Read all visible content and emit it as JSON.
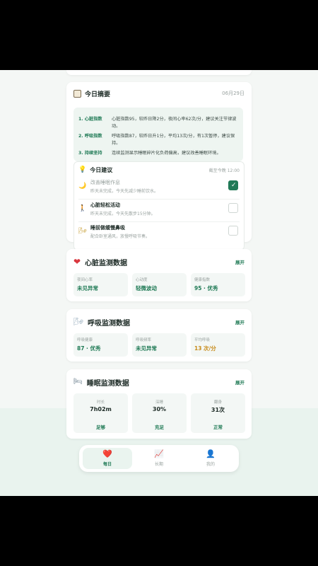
{
  "summary": {
    "title": "今日摘要",
    "date": "06月29日",
    "items": [
      {
        "label": "1. 心脏指数",
        "text": "心脏指数95，较昨日降2分，夜间心率62次/分，建议关注节律波动。"
      },
      {
        "label": "2. 呼吸指数",
        "text": "呼吸指数87，较昨日升1分，平均13次/分，有1次暂停，建议保持。"
      },
      {
        "label": "3. 持续坚持",
        "text": "连续监测显示睡眠碎片化负荷偏高，建议改善睡眠环境。"
      }
    ]
  },
  "advice": {
    "title": "今日建议",
    "time": "截至今晚 12:00",
    "items": [
      {
        "icon": "moon-icon",
        "glyph": "🌙",
        "title": "改善睡眠作息",
        "desc": "昨天未完成，今天先减少睡前饮水。",
        "checked": true
      },
      {
        "icon": "walk-icon",
        "glyph": "🚶",
        "title": "心脏轻松活动",
        "desc": "昨天未完成，今天先散步15分钟。",
        "checked": false
      },
      {
        "icon": "wind-icon",
        "glyph": "🌬",
        "title": "睡前做缓慢鼻吸",
        "desc": "配合卧室通风，放慢呼吸节奏。",
        "checked": false
      }
    ]
  },
  "heart": {
    "title": "心脏监测数据",
    "expand": "展开",
    "stats": [
      {
        "label": "夜间心率",
        "value": "未见异常"
      },
      {
        "label": "心动度",
        "value": "轻微波动"
      },
      {
        "label": "健康指数",
        "value": "95 · 优秀"
      }
    ]
  },
  "breath": {
    "title": "呼吸监测数据",
    "expand": "展开",
    "stats": [
      {
        "label": "呼吸健康",
        "value": "87 · 优秀"
      },
      {
        "label": "呼吸频率",
        "value": "未见异常"
      },
      {
        "label": "平均呼吸",
        "value": "13 次/分"
      }
    ]
  },
  "sleep": {
    "title": "睡眠监测数据",
    "expand": "展开",
    "stats": [
      {
        "label": "时长",
        "value": "7h02m",
        "foot": "足够"
      },
      {
        "label": "深睡",
        "value": "30%",
        "foot": "充足"
      },
      {
        "label": "翻身",
        "value": "31次",
        "foot": "正常"
      }
    ]
  },
  "tabs": [
    {
      "label": "每日",
      "icon": "heart-icon",
      "glyph": "❤️"
    },
    {
      "label": "长期",
      "icon": "chart-icon",
      "glyph": "📈"
    },
    {
      "label": "我的",
      "icon": "user-icon",
      "glyph": "👤"
    }
  ],
  "colors": {
    "accent": "#1f7a55",
    "warning": "#c78a18",
    "heart": "#d9363e"
  }
}
